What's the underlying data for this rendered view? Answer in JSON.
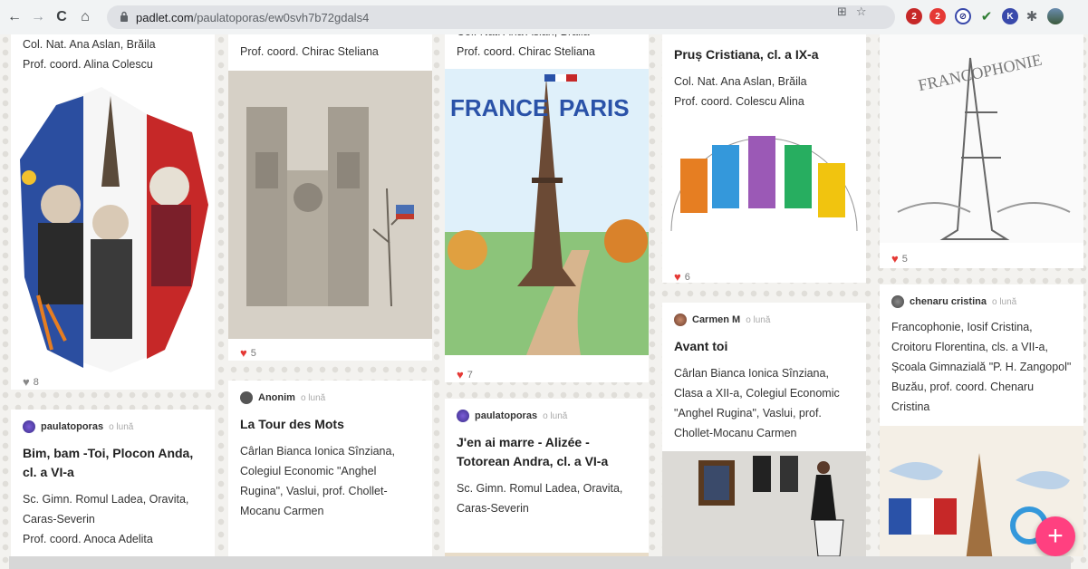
{
  "browser": {
    "back_glyph": "←",
    "forward_glyph": "→",
    "reload_glyph": "C",
    "home_glyph": "⌂",
    "url_host": "padlet.com",
    "url_path": "/paulatoporas/ew0svh7b72gdals4",
    "lock_icon": "lock-icon",
    "ext_badge_1": "2",
    "ext_badge_2": "2"
  },
  "cards": {
    "c1": {
      "line1": "Col. Nat. Ana Aslan, Brăila",
      "line2": "Prof. coord. Alina Colescu",
      "likes": "8"
    },
    "c2": {
      "author": "paulatoporas",
      "ago": "o lună",
      "title": "Bim, bam -Toi, Plocon Anda, cl. a VI-a",
      "body_lines": [
        "Sc. Gimn. Romul Ladea, Oravita,",
        "Caras-Severin",
        "Prof. coord. Anoca Adelita"
      ]
    },
    "c3": {
      "line1": "Prof. coord. Chirac Steliana",
      "likes": "5"
    },
    "c4": {
      "author": "Anonim",
      "ago": "o lună",
      "title": "La Tour des Mots",
      "body_lines": [
        "Cârlan Bianca Ionica Sînziana,",
        "Colegiul Economic \"Anghel",
        "Rugina\", Vaslui, prof. Chollet-",
        "Mocanu Carmen"
      ]
    },
    "c5": {
      "line0": "Col. Nat. Ana Aslan, Braila",
      "line1": "Prof. coord. Chirac Steliana",
      "likes": "7",
      "img_text_left": "FRANCE",
      "img_text_right": "PARIS"
    },
    "c6": {
      "author": "paulatoporas",
      "ago": "o lună",
      "title": "J'en ai marre - Alizée - Totorean Andra, cl. a VI-a",
      "body_lines": [
        "Sc. Gimn. Romul Ladea, Oravita,",
        "Caras-Severin"
      ]
    },
    "c7": {
      "title": "Pruș Cristiana, cl. a IX-a",
      "body_lines": [
        "Col. Nat. Ana Aslan, Brăila",
        "Prof. coord. Colescu Alina"
      ],
      "likes": "6"
    },
    "c8": {
      "author": "Carmen M",
      "ago": "o lună",
      "title": "Avant toi",
      "body_lines": [
        "Cârlan Bianca Ionica Sînziana,",
        "Clasa a XII-a, Colegiul Economic",
        "\"Anghel Rugina\", Vaslui, prof.",
        "Chollet-Mocanu Carmen"
      ]
    },
    "c9": {
      "likes": "5",
      "img_text": "FRANCOPHONIE"
    },
    "c10": {
      "author": "chenaru cristina",
      "ago": "o lună",
      "body_lines": [
        "Francophonie, Iosif Cristina,",
        "Croitoru Florentina, cls. a VII-a,",
        "Școala Gimnazială \"P. H. Zangopol\"",
        "Buzău, prof. coord. Chenaru",
        "Cristina"
      ]
    }
  },
  "fab": {
    "label": "+"
  },
  "colors": {
    "accent": "#ff4080",
    "heart": "#e53935",
    "address_bar": "#dfe1e5"
  }
}
